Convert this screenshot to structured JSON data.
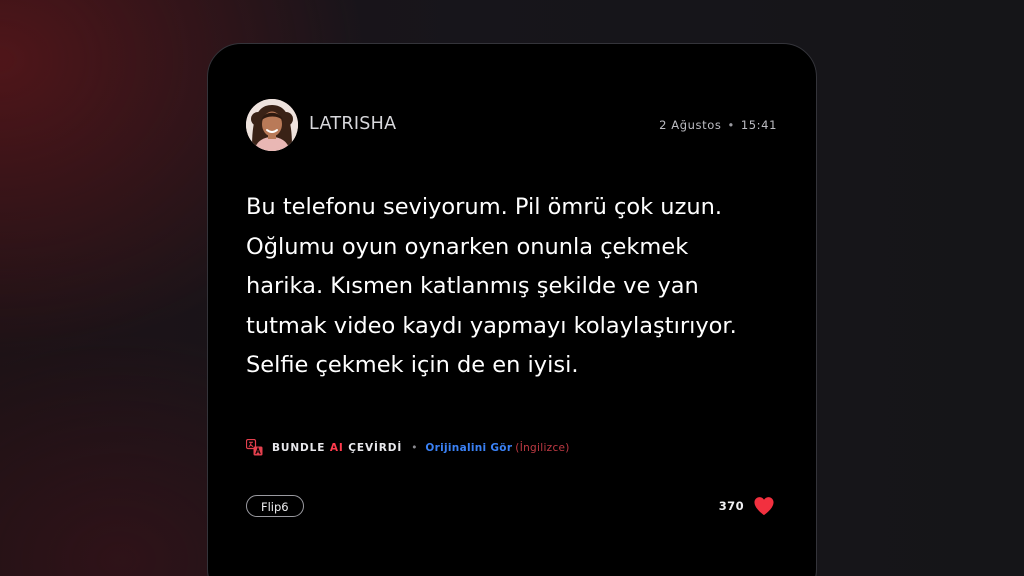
{
  "post": {
    "username": "LATRISHA",
    "date": "2 Ağustos",
    "separator": "•",
    "time": "15:41",
    "review_lines": [
      "Bu telefonu seviyorum. Pil ömrü çok uzun.",
      "Oğlumu oyun oynarken onunla çekmek",
      "harika. Kısmen katlanmış şekilde ve yan",
      "tutmak video kaydı yapmayı kolaylaştırıyor.",
      "Selfie çekmek için de en iyisi."
    ]
  },
  "translation": {
    "icon": "translate-icon",
    "label_part1": "BUNDLE",
    "label_ai": "AI",
    "label_part2": "ÇEVİRDİ",
    "separator": "•",
    "original_link": "Orijinalini Gör",
    "original_language": "(İngilizce)"
  },
  "footer": {
    "tag": "Flip6",
    "like_count": "370",
    "like_icon": "heart-icon"
  },
  "colors": {
    "accent_red": "#ff3b4d",
    "link_blue": "#3b82f6",
    "heart": "#f2303f",
    "card_background": "#000000"
  }
}
